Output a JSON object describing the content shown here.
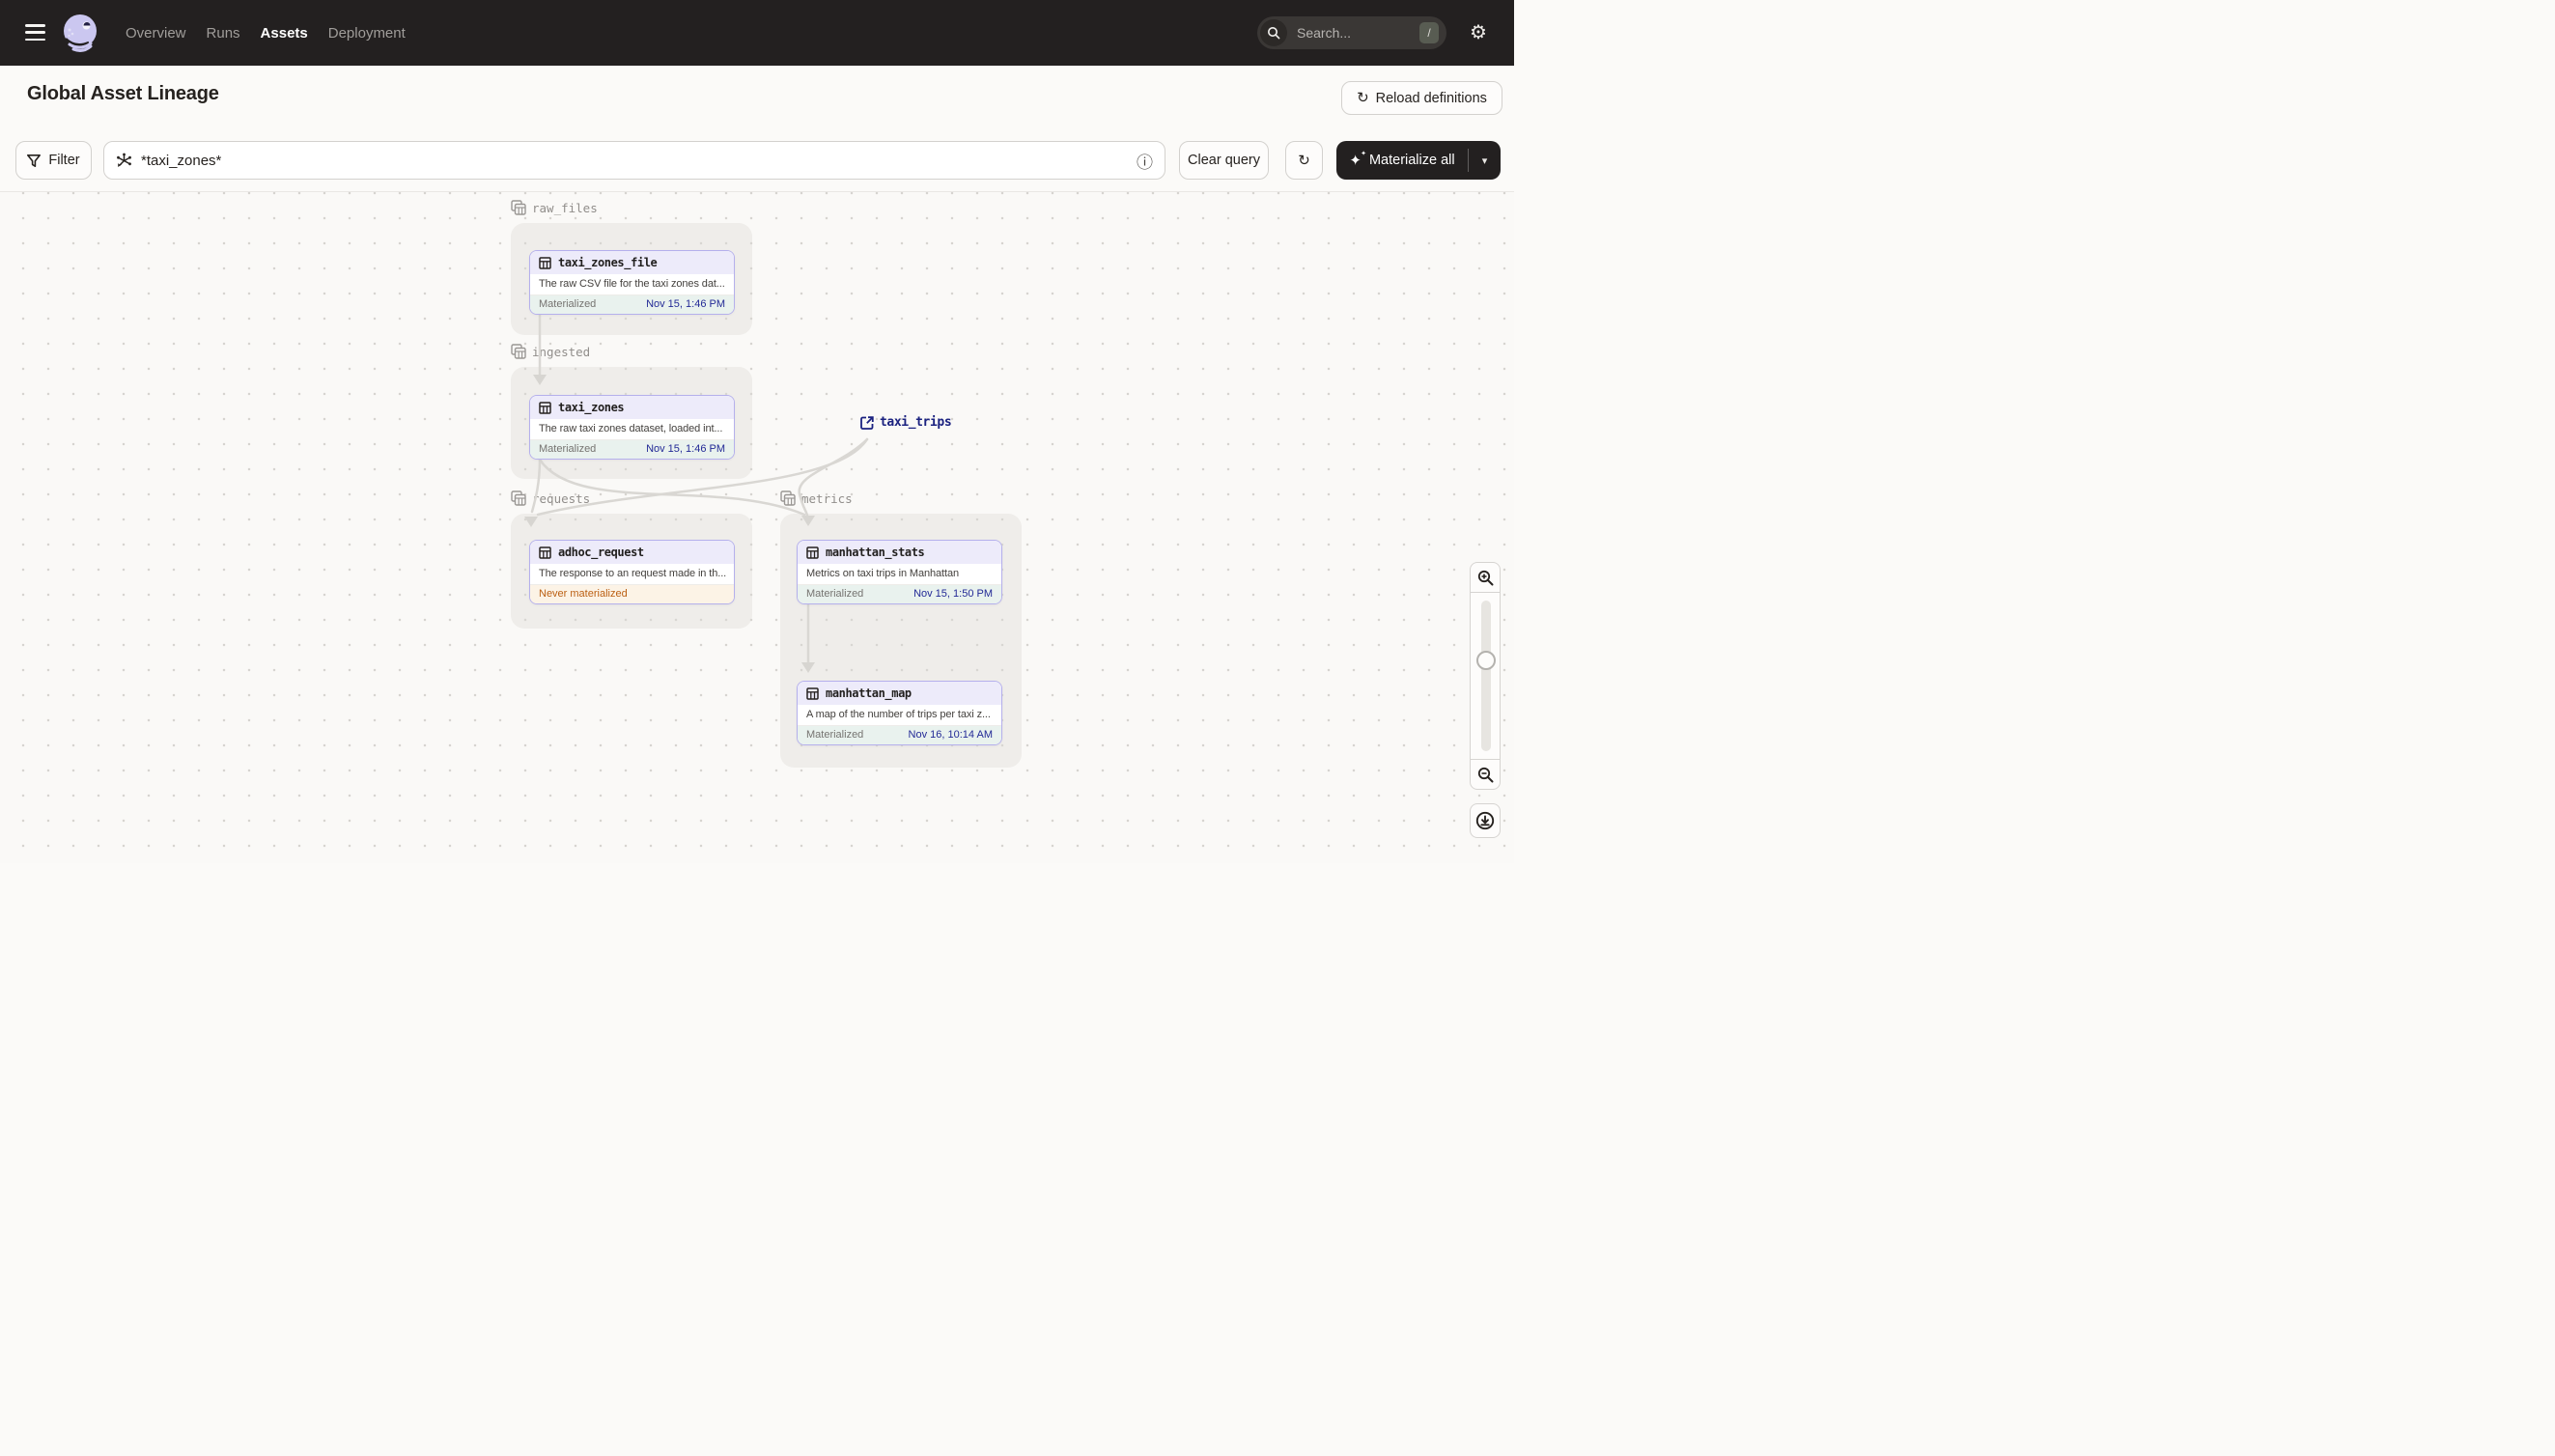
{
  "topbar": {
    "nav": [
      {
        "label": "Overview",
        "active": false
      },
      {
        "label": "Runs",
        "active": false
      },
      {
        "label": "Assets",
        "active": true
      },
      {
        "label": "Deployment",
        "active": false
      }
    ],
    "search_placeholder": "Search...",
    "search_shortcut": "/"
  },
  "header": {
    "title": "Global Asset Lineage",
    "reload_button": "Reload definitions"
  },
  "toolbar": {
    "filter_button": "Filter",
    "query_value": "*taxi_zones*",
    "clear_button": "Clear query",
    "materialize_button": "Materialize all"
  },
  "icons": {
    "gear": "⚙",
    "refresh": "↻",
    "info": "ⓘ",
    "caret": "▾",
    "sparkle": "✦",
    "sparkle_mini": "✦"
  },
  "graph": {
    "groups": [
      {
        "name": "raw_files"
      },
      {
        "name": "ingested"
      },
      {
        "name": "requests"
      },
      {
        "name": "metrics"
      }
    ],
    "nodes": [
      {
        "name": "taxi_zones_file",
        "group": "raw_files",
        "description": "The raw CSV file for the taxi zones dat...",
        "status": "Materialized",
        "timestamp": "Nov 15, 1:46 PM"
      },
      {
        "name": "taxi_zones",
        "group": "ingested",
        "description": "The raw taxi zones dataset, loaded int...",
        "status": "Materialized",
        "timestamp": "Nov 15, 1:46 PM"
      },
      {
        "name": "adhoc_request",
        "group": "requests",
        "description": "The response to an request made in th...",
        "status": "Never materialized",
        "timestamp": ""
      },
      {
        "name": "manhattan_stats",
        "group": "metrics",
        "description": "Metrics on taxi trips in Manhattan",
        "status": "Materialized",
        "timestamp": "Nov 15, 1:50 PM"
      },
      {
        "name": "manhattan_map",
        "group": "metrics",
        "description": "A map of the number of trips per taxi z...",
        "status": "Materialized",
        "timestamp": "Nov 16, 10:14 AM"
      }
    ],
    "external_assets": [
      {
        "name": "taxi_trips"
      }
    ],
    "edges": [
      [
        "taxi_zones_file",
        "taxi_zones"
      ],
      [
        "taxi_zones",
        "adhoc_request"
      ],
      [
        "taxi_zones",
        "manhattan_stats"
      ],
      [
        "taxi_trips",
        "adhoc_request"
      ],
      [
        "taxi_trips",
        "manhattan_stats"
      ],
      [
        "manhattan_stats",
        "manhattan_map"
      ]
    ]
  },
  "colors": {
    "topbar_bg": "#232020",
    "node_border": "#b5b0ec",
    "node_header_bg": "#edebfa",
    "materialized_bg": "#e9f2ee",
    "materialized_time": "#232a96",
    "never_materialized_bg": "#fcf3e6",
    "never_materialized_text": "#bb5f12",
    "edge": "#d9d7d3"
  }
}
